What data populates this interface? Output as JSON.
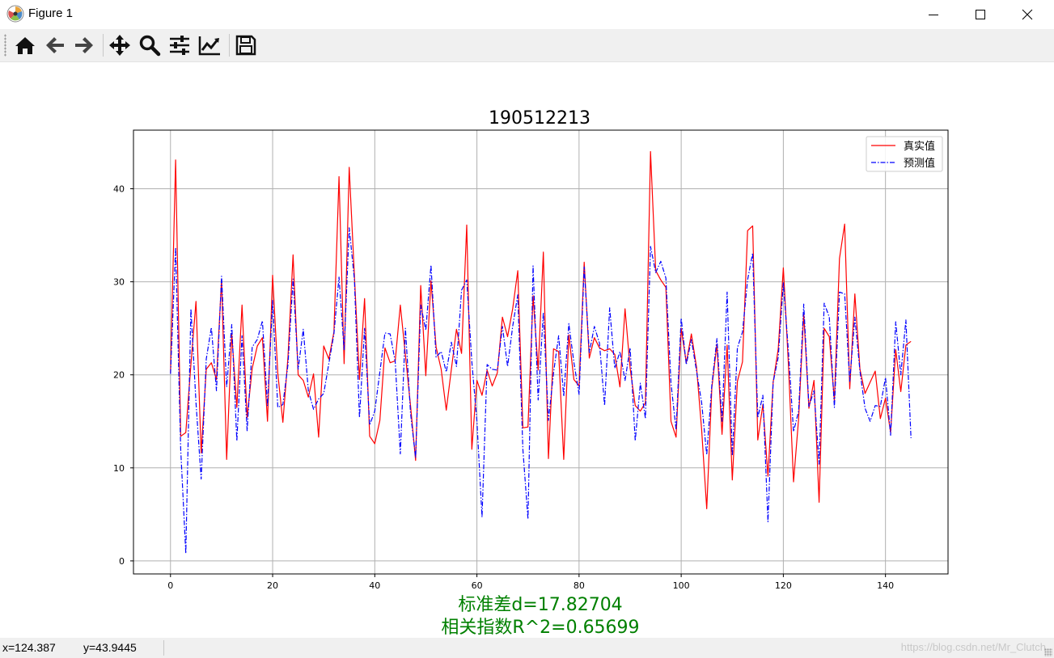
{
  "window": {
    "title": "Figure 1",
    "icon": "matplotlib-logo-icon"
  },
  "window_controls": [
    "minimize-icon",
    "maximize-icon",
    "close-icon"
  ],
  "toolbar": {
    "buttons": [
      {
        "name": "home",
        "icon": "home-icon"
      },
      {
        "name": "back",
        "icon": "arrow-left-icon"
      },
      {
        "name": "forward",
        "icon": "arrow-right-icon"
      },
      {
        "name": "pan",
        "icon": "move-icon"
      },
      {
        "name": "zoom",
        "icon": "magnifier-icon"
      },
      {
        "name": "subplots",
        "icon": "sliders-icon"
      },
      {
        "name": "customize",
        "icon": "chart-trend-icon"
      },
      {
        "name": "save",
        "icon": "floppy-disk-icon"
      }
    ]
  },
  "colors": {
    "true_series": "#ff0000",
    "pred_series": "#0000ff",
    "metrics_text": "#008000",
    "grid": "#b0b0b0"
  },
  "chart_data": {
    "type": "line",
    "title": "190512213",
    "xlabel": "",
    "ylabel": "",
    "xlim": [
      -7.25,
      152.25
    ],
    "ylim": [
      -1.4,
      46.3
    ],
    "xticks": [
      0,
      20,
      40,
      60,
      80,
      100,
      120,
      140
    ],
    "yticks": [
      0,
      10,
      20,
      30,
      40
    ],
    "grid": true,
    "legend_position": "top-right",
    "series": [
      {
        "name": "真实值",
        "style": "solid",
        "color": "#ff0000",
        "values": [
          20.2,
          43.1,
          13.4,
          13.8,
          21.1,
          27.9,
          11.6,
          20.6,
          21.3,
          19.5,
          30.3,
          10.9,
          24.4,
          16.5,
          27.5,
          15.4,
          20.7,
          23.1,
          24.0,
          15.0,
          30.7,
          20.2,
          14.9,
          21.9,
          32.9,
          20.0,
          19.4,
          17.6,
          20.1,
          13.3,
          23.1,
          21.7,
          24.6,
          41.3,
          21.2,
          42.3,
          30.7,
          19.5,
          28.2,
          13.4,
          12.6,
          15.1,
          22.9,
          21.3,
          21.5,
          27.5,
          22.1,
          16.7,
          10.8,
          29.6,
          19.9,
          30.1,
          23.0,
          20.6,
          16.2,
          20.6,
          24.9,
          22.3,
          36.1,
          12.0,
          19.4,
          17.8,
          20.5,
          18.8,
          20.2,
          26.2,
          24.1,
          27.1,
          31.2,
          14.3,
          14.4,
          28.5,
          20.5,
          33.2,
          11.0,
          22.8,
          22.5,
          10.9,
          24.3,
          19.5,
          18.8,
          32.1,
          21.8,
          24.0,
          22.9,
          22.6,
          22.8,
          22.2,
          18.7,
          27.1,
          20.7,
          16.7,
          16.1,
          17.0,
          44.0,
          31.2,
          30.2,
          29.4,
          15.0,
          13.3,
          25.0,
          21.3,
          24.4,
          20.8,
          14.1,
          5.6,
          18.6,
          23.3,
          13.6,
          23.2,
          8.7,
          19.3,
          21.4,
          35.5,
          36.0,
          13.0,
          16.8,
          9.1,
          19.2,
          22.8,
          31.5,
          21.1,
          8.5,
          15.3,
          26.6,
          16.4,
          19.4,
          6.3,
          25.0,
          24.1,
          17.2,
          32.5,
          36.2,
          18.5,
          28.7,
          20.6,
          18.0,
          19.2,
          20.4,
          15.3,
          17.5,
          13.8,
          22.7,
          18.2,
          23.2,
          23.6
        ]
      },
      {
        "name": "预测值",
        "style": "dashdot",
        "color": "#0000ff",
        "values": [
          20.1,
          33.7,
          12.0,
          0.8,
          27.1,
          17.0,
          8.8,
          21.7,
          25.1,
          18.3,
          30.6,
          18.7,
          25.4,
          12.9,
          24.2,
          14.0,
          23.0,
          23.8,
          25.8,
          16.7,
          28.0,
          16.5,
          16.8,
          21.1,
          30.3,
          20.6,
          24.9,
          18.3,
          16.3,
          17.4,
          18.0,
          21.2,
          24.4,
          30.5,
          22.7,
          35.8,
          30.3,
          15.4,
          25.0,
          14.6,
          16.1,
          20.3,
          24.5,
          24.4,
          21.4,
          11.5,
          25.0,
          15.9,
          11.1,
          27.5,
          24.8,
          31.8,
          21.9,
          22.5,
          20.3,
          23.5,
          20.9,
          29.1,
          30.2,
          21.4,
          15.0,
          4.7,
          21.1,
          20.6,
          20.5,
          25.2,
          20.9,
          25.2,
          28.6,
          12.0,
          4.5,
          31.7,
          17.3,
          26.7,
          15.1,
          20.2,
          24.2,
          17.7,
          25.5,
          21.3,
          17.9,
          31.6,
          22.4,
          25.2,
          23.4,
          16.7,
          27.2,
          20.7,
          22.5,
          19.4,
          22.9,
          12.9,
          19.1,
          15.3,
          33.8,
          31.0,
          32.2,
          30.4,
          19.1,
          14.1,
          26.1,
          21.1,
          23.8,
          20.4,
          17.0,
          11.4,
          18.9,
          23.9,
          15.0,
          28.9,
          11.3,
          22.9,
          24.6,
          30.2,
          33.1,
          15.4,
          17.8,
          4.2,
          19.2,
          21.9,
          29.9,
          22.5,
          13.9,
          16.1,
          27.6,
          16.6,
          18.3,
          10.4,
          27.7,
          26.2,
          16.5,
          28.9,
          28.7,
          19.3,
          26.2,
          20.4,
          16.4,
          15.0,
          16.7,
          16.6,
          19.7,
          13.5,
          25.7,
          20.0,
          25.9,
          13.2
        ]
      }
    ],
    "annotations": [
      "标准差d=17.82704",
      "相关指数R^2=0.65699"
    ]
  },
  "status": {
    "x_readout": "x=124.387",
    "y_readout": "y=43.9445",
    "watermark": "https://blog.csdn.net/Mr_Clutch"
  }
}
